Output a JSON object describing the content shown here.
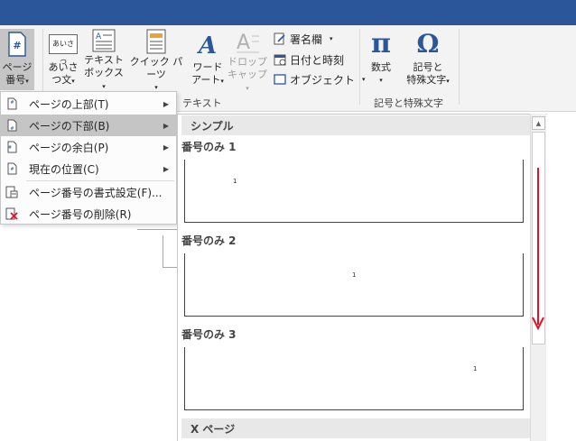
{
  "ribbon": {
    "page_number": {
      "line1": "ページ",
      "line2": "番号",
      "icon": "page-number-icon"
    },
    "greeting": {
      "line1": "あいさ",
      "line2": "つ文",
      "icon_text": "あいさつ"
    },
    "textbox": {
      "line1": "テキスト",
      "line2": "ボックス"
    },
    "quick_parts": {
      "label": "クイック パーツ"
    },
    "wordart": {
      "line1": "ワード",
      "line2": "アート"
    },
    "dropcap": {
      "line1": "ドロップ",
      "line2": "キャップ"
    },
    "signature": "署名欄",
    "datetime": "日付と時刻",
    "object": "オブジェクト",
    "equation": {
      "label": "数式",
      "glyph": "π"
    },
    "symbol": {
      "line1": "記号と",
      "line2": "特殊文字",
      "glyph": "Ω"
    },
    "group_text": "テキスト",
    "group_symbols": "記号と特殊文字"
  },
  "menu": {
    "items": [
      {
        "label": "ページの上部(T)",
        "icon": "page-top-icon",
        "has_submenu": true
      },
      {
        "label": "ページの下部(B)",
        "icon": "page-bottom-icon",
        "has_submenu": true,
        "highlighted": true
      },
      {
        "label": "ページの余白(P)",
        "icon": "page-margin-icon",
        "has_submenu": true
      },
      {
        "label": "現在の位置(C)",
        "icon": "current-position-icon",
        "has_submenu": true
      },
      {
        "label": "ページ番号の書式設定(F)...",
        "icon": "format-page-number-icon",
        "has_submenu": false
      },
      {
        "label": "ページ番号の削除(R)",
        "icon": "remove-page-number-icon",
        "has_submenu": false
      }
    ]
  },
  "gallery": {
    "section_simple": "シンプル",
    "items": [
      {
        "title": "番号のみ 1",
        "number": "1"
      },
      {
        "title": "番号のみ 2",
        "number": "1"
      },
      {
        "title": "番号のみ 3",
        "number": "1"
      }
    ],
    "section_next": "X ページ"
  },
  "colors": {
    "title_bar": "#2b579a",
    "highlight": "#c5c5c5",
    "accent_blue": "#2b579a",
    "annotation_red": "#e81123"
  }
}
